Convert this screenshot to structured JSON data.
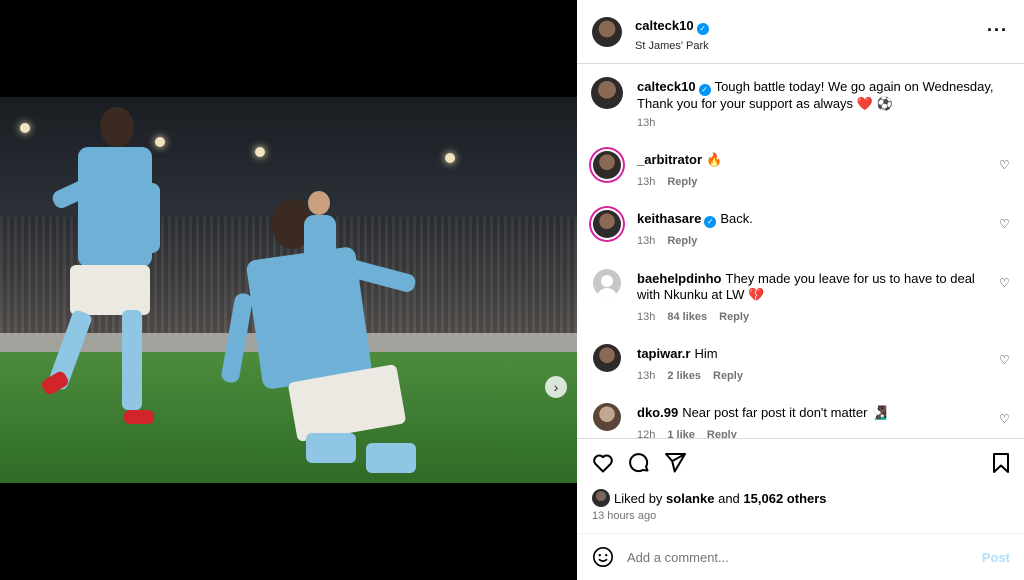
{
  "post": {
    "author": "calteck10",
    "location": "St James' Park",
    "more_icon": "more-horizontal-icon",
    "carousel": {
      "slides": 4,
      "active": 0
    }
  },
  "caption": {
    "user": "calteck10",
    "text": "Tough battle today! We go again on Wednesday, Thank you for your support as always ❤️ ⚽",
    "time": "13h"
  },
  "comments": [
    {
      "user": "_arbitrator",
      "text": "🔥",
      "time": "13h",
      "likes": "",
      "reply": "Reply",
      "verified": false
    },
    {
      "user": "keithasare",
      "text": "Back.",
      "time": "13h",
      "likes": "",
      "reply": "Reply",
      "verified": true
    },
    {
      "user": "baehelpdinho",
      "text": "They made you leave for us to have to deal with Nkunku at LW 💔",
      "time": "13h",
      "likes": "84 likes",
      "reply": "Reply",
      "verified": false
    },
    {
      "user": "tapiwar.r",
      "text": "Him",
      "time": "13h",
      "likes": "2 likes",
      "reply": "Reply",
      "verified": false
    },
    {
      "user": "dko.99",
      "text": "Near post far post it don't matter 🧏🏿‍♂️",
      "time": "12h",
      "likes": "1 like",
      "reply": "Reply",
      "verified": false
    }
  ],
  "likes": {
    "prefix": "Liked by",
    "user": "solanke",
    "and": "and",
    "count": "15,062 others"
  },
  "time_ago": "13 hours ago",
  "add_comment": {
    "placeholder": "Add a comment...",
    "post_label": "Post"
  },
  "colors": {
    "accent": "#0095f6",
    "post_disabled": "#b2dffc",
    "like_red": "#ed4956"
  }
}
